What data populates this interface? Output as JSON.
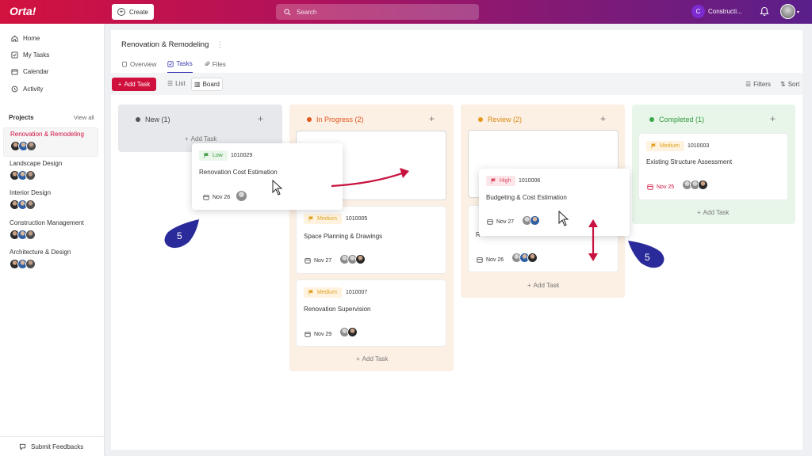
{
  "app": {
    "logo": "Orta!",
    "create_label": "Create",
    "search_placeholder": "Search",
    "workspace_initial": "C",
    "workspace_name": "Constructi..."
  },
  "sidebar": {
    "nav": [
      {
        "label": "Home"
      },
      {
        "label": "My Tasks"
      },
      {
        "label": "Calendar"
      },
      {
        "label": "Activity"
      }
    ],
    "projects_header": "Projects",
    "view_all": "View all",
    "projects": [
      {
        "name": "Renovation & Remodeling",
        "active": true
      },
      {
        "name": "Landscape Design"
      },
      {
        "name": "Interior Design"
      },
      {
        "name": "Construction Management"
      },
      {
        "name": "Architecture & Design"
      }
    ],
    "feedback": "Submit Feedbacks"
  },
  "page": {
    "title": "Renovation & Remodeling",
    "tabs": [
      {
        "label": "Overview"
      },
      {
        "label": "Tasks",
        "active": true
      },
      {
        "label": "Files"
      }
    ],
    "add_task": "Add Task",
    "views": {
      "list": "List",
      "board": "Board"
    },
    "filters": "Filters",
    "sort": "Sort"
  },
  "columns": {
    "new": {
      "title": "New (1)",
      "color": "#555555",
      "add": "Add Task"
    },
    "progress": {
      "title": "In Progress (2)",
      "color": "#e2571e",
      "add": "Add Task"
    },
    "review": {
      "title": "Review (2)",
      "color": "#e29a1e",
      "add": "Add Task"
    },
    "completed": {
      "title": "Completed (1)",
      "color": "#3aa84a",
      "add": "Add Task"
    }
  },
  "cards": {
    "dragged_new": {
      "priority": "Low",
      "id": "1010029",
      "title": "Renovation Cost Estimation",
      "date": "Nov 26"
    },
    "progress_1": {
      "priority": "Medium",
      "id": "1010005",
      "title": "Space Planning & Drawings",
      "date": "Nov 27"
    },
    "progress_2": {
      "priority": "Medium",
      "id": "1010007",
      "title": "Renovation Supervision",
      "date": "Nov 29"
    },
    "dragged_review": {
      "priority": "High",
      "id": "1010006",
      "title": "Budgeting & Cost Estimation",
      "date": "Nov 27"
    },
    "review_behind": {
      "title_partial": "R",
      "date": "Nov 26"
    },
    "completed_1": {
      "priority": "Medium",
      "id": "1010003",
      "title": "Existing Structure Assessment",
      "date": "Nov 25"
    }
  },
  "markers": {
    "left": "5",
    "right": "5"
  },
  "colors": {
    "brand": "#d0103c",
    "accent_purple": "#3b3bb4",
    "marker": "#2a2a9a"
  }
}
